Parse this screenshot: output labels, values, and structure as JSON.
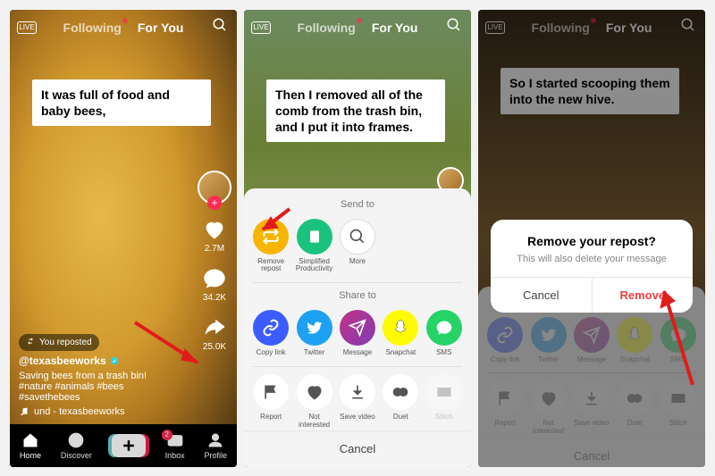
{
  "header": {
    "live": "LIVE",
    "following": "Following",
    "foryou": "For You"
  },
  "screen1": {
    "caption": "It was full of food and baby bees,",
    "reposted": "You reposted",
    "username": "@texasbeeworks",
    "desc": "Saving bees from a trash bin! #nature #animals #bees #savethebees",
    "music": "und - texasbeeworks",
    "likes": "2.7M",
    "comments": "34.2K",
    "shares": "25.0K",
    "nav": {
      "home": "Home",
      "discover": "Discover",
      "inbox": "Inbox",
      "profile": "Profile",
      "inbox_badge": "2"
    }
  },
  "screen2": {
    "caption": "Then I removed all of the comb from the trash bin, and I put it into frames.",
    "send_to": "Send to",
    "remove_repost": "Remove repost",
    "simplified": "Simplified Productivity",
    "more": "More",
    "share_to": "Share to",
    "copy_link": "Copy link",
    "twitter": "Twitter",
    "message": "Message",
    "snapchat": "Snapchat",
    "sms": "SMS",
    "report": "Report",
    "not_interested": "Not interested",
    "save_video": "Save video",
    "duet": "Duet",
    "stitch": "Stitch",
    "cancel": "Cancel"
  },
  "screen3": {
    "caption": "So I started scooping them into the new hive.",
    "dialog_title": "Remove your repost?",
    "dialog_msg": "This will also delete your message",
    "cancel": "Cancel",
    "remove": "Remove"
  },
  "colors": {
    "accent": "#fe2c55",
    "remove_repost_btn": "#f7b500",
    "twitter": "#1da1f2",
    "copylink": "#3b5cff",
    "message": "#8134af",
    "snapchat": "#fffc00",
    "sms": "#25d366"
  }
}
